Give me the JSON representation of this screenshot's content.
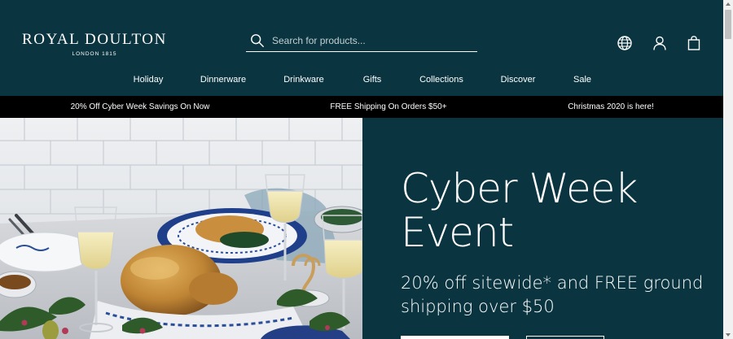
{
  "header": {
    "logo_main": "ROYAL DOULTON",
    "logo_sub": "LONDON 1815",
    "search_placeholder": "Search for products...",
    "icons": [
      "globe-icon",
      "user-icon",
      "bag-icon"
    ]
  },
  "nav": {
    "items": [
      {
        "label": "Holiday"
      },
      {
        "label": "Dinnerware"
      },
      {
        "label": "Drinkware"
      },
      {
        "label": "Gifts"
      },
      {
        "label": "Collections"
      },
      {
        "label": "Discover"
      },
      {
        "label": "Sale"
      }
    ]
  },
  "promo_bar": {
    "messages": [
      "20% Off Cyber Week Savings On Now",
      "FREE Shipping On Orders $50+",
      "Christmas 2020 is here!"
    ]
  },
  "hero": {
    "title_line1": "Cyber Week",
    "title_line2": "Event",
    "subtitle": "20% off sitewide* and FREE ground shipping over $50"
  },
  "colors": {
    "brand_teal": "#0a3540",
    "promo_bar": "#000000",
    "text_light": "#ffffff"
  }
}
